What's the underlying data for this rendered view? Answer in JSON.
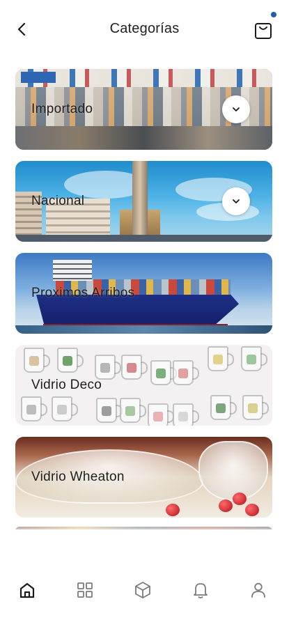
{
  "header": {
    "title": "Categorías",
    "back_icon": "back-arrow-icon",
    "cart_icon": "shopping-bag-icon",
    "cart_badge_color": "#1f5fa8"
  },
  "categories": [
    {
      "label": "Importado",
      "expandable": true
    },
    {
      "label": "Nacional",
      "expandable": true
    },
    {
      "label": "Proximos Arribos",
      "expandable": false
    },
    {
      "label": "Vidrio Deco",
      "expandable": false
    },
    {
      "label": "Vidrio Wheaton",
      "expandable": false
    }
  ],
  "bottom_nav": {
    "items": [
      {
        "name": "home",
        "icon": "home-icon",
        "active": true
      },
      {
        "name": "categories",
        "icon": "grid-icon",
        "active": false
      },
      {
        "name": "products",
        "icon": "box-icon",
        "active": false
      },
      {
        "name": "notifications",
        "icon": "bell-icon",
        "active": false
      },
      {
        "name": "profile",
        "icon": "user-icon",
        "active": false
      }
    ]
  },
  "colors": {
    "text": "#1a1a1a",
    "icon": "#7a7a7a",
    "icon_active": "#1a1a1a"
  }
}
